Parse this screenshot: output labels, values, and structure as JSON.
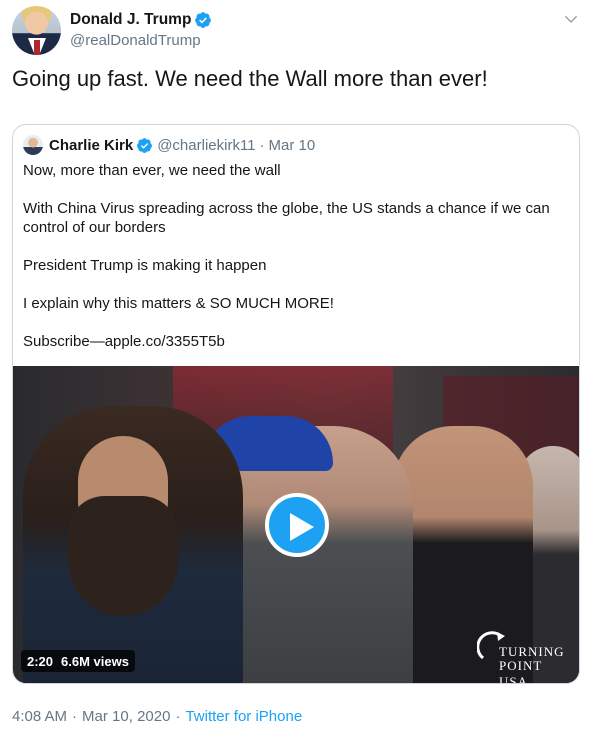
{
  "author": {
    "display_name": "Donald J. Trump",
    "handle": "@realDonaldTrump",
    "verified": true
  },
  "tweet": {
    "text": "Going up fast. We need the Wall more than ever!"
  },
  "quoted_tweet": {
    "display_name": "Charlie Kirk",
    "handle": "@charliekirk11",
    "separator": "·",
    "date": "Mar 10",
    "paragraphs": [
      "Now, more than ever, we need the wall",
      "With China Virus spreading across the globe, the US stands a chance if we can control of our borders",
      "President Trump is making it happen",
      "I explain why this matters & SO MUCH MORE!",
      "Subscribe—apple.co/3355T5b"
    ],
    "video": {
      "duration": "2:20",
      "views": "6.6M views",
      "brand_line1": "TURNING",
      "brand_line2": "POINT USA"
    }
  },
  "footer": {
    "time": "4:08 AM",
    "separator": "·",
    "date": "Mar 10, 2020",
    "source": "Twitter for iPhone"
  },
  "colors": {
    "accent": "#1da1f2",
    "secondary_text": "#657786",
    "border": "#ccd6dd"
  },
  "icons": {
    "verified": "verified-badge-icon",
    "menu": "chevron-down-icon",
    "play": "play-icon"
  }
}
